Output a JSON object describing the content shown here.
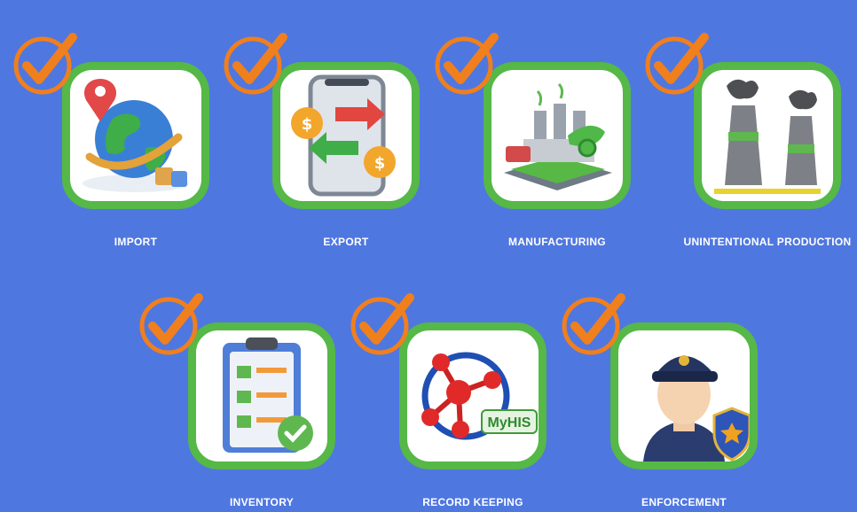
{
  "items": [
    {
      "label": "IMPORT",
      "icon": "globe-import-icon"
    },
    {
      "label": "EXPORT",
      "icon": "phone-export-icon"
    },
    {
      "label": "MANUFACTURING",
      "icon": "factory-icon"
    },
    {
      "label": "UNINTENTIONAL PRODUCTION",
      "icon": "chimneys-icon"
    },
    {
      "label": "INVENTORY",
      "icon": "clipboard-checklist-icon"
    },
    {
      "label": "RECORD KEEPING",
      "icon": "molecule-records-icon"
    },
    {
      "label": "ENFORCEMENT",
      "icon": "police-officer-icon"
    }
  ],
  "logo_text": "MyHIS",
  "colors": {
    "background": "#4f77e0",
    "tile_border": "#55b847",
    "check": "#f07f1e",
    "label": "#ffffff"
  }
}
